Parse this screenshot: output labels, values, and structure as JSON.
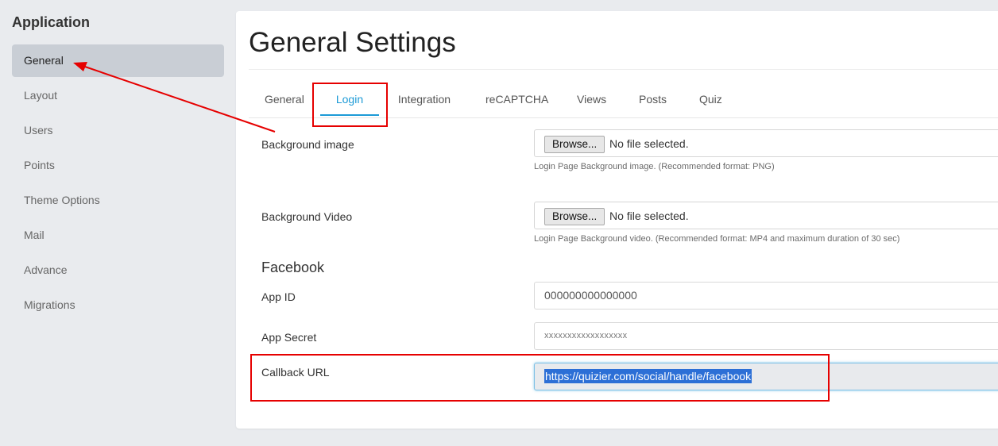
{
  "sidebar": {
    "title": "Application",
    "items": [
      {
        "label": "General"
      },
      {
        "label": "Layout"
      },
      {
        "label": "Users"
      },
      {
        "label": "Points"
      },
      {
        "label": "Theme Options"
      },
      {
        "label": "Mail"
      },
      {
        "label": "Advance"
      },
      {
        "label": "Migrations"
      }
    ],
    "active_index": 0
  },
  "main": {
    "title": "General Settings",
    "tabs": [
      {
        "label": "General"
      },
      {
        "label": "Login"
      },
      {
        "label": "Integration"
      },
      {
        "label": "reCAPTCHA"
      },
      {
        "label": "Views"
      },
      {
        "label": "Posts"
      },
      {
        "label": "Quiz"
      }
    ],
    "active_tab": "Login",
    "fields": {
      "background_image": {
        "label": "Background image",
        "button": "Browse...",
        "status": "No file selected.",
        "help": "Login Page Background image. (Recommended format: PNG)"
      },
      "background_video": {
        "label": "Background Video",
        "button": "Browse...",
        "status": "No file selected.",
        "help": "Login Page Background video. (Recommended format: MP4 and maximum duration of 30 sec)"
      },
      "facebook_heading": "Facebook",
      "app_id": {
        "label": "App ID",
        "value": "000000000000000"
      },
      "app_secret": {
        "label": "App Secret",
        "value": "xxxxxxxxxxxxxxxxxx"
      },
      "callback_url": {
        "label": "Callback URL",
        "value": "https://quizier.com/social/handle/facebook"
      }
    }
  },
  "colors": {
    "accent": "#1c9ad6",
    "annotation": "#e60000",
    "selection": "#2c6fd6",
    "sidebar_active": "#c9ced5"
  }
}
